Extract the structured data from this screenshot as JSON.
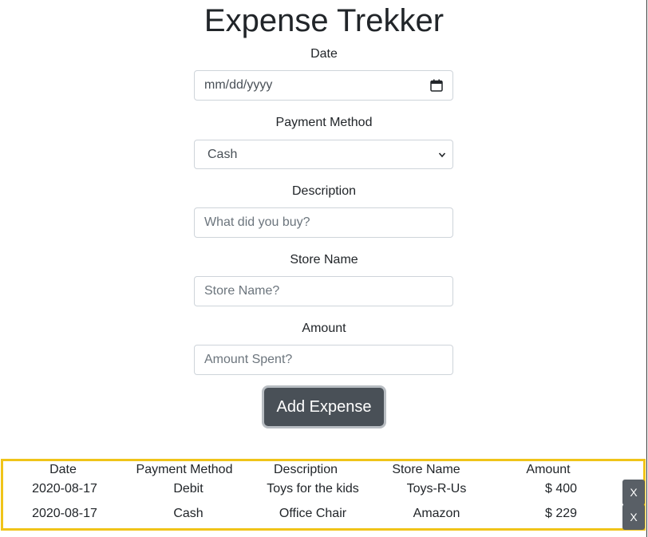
{
  "app": {
    "title": "Expense Trekker"
  },
  "form": {
    "date": {
      "label": "Date",
      "placeholder": "mm/dd/yyyy"
    },
    "payment_method": {
      "label": "Payment Method",
      "selected": "Cash"
    },
    "description": {
      "label": "Description",
      "placeholder": "What did you buy?"
    },
    "store_name": {
      "label": "Store Name",
      "placeholder": "Store Name?"
    },
    "amount": {
      "label": "Amount",
      "placeholder": "Amount Spent?"
    },
    "submit_label": "Add Expense"
  },
  "table": {
    "headers": [
      "Date",
      "Payment Method",
      "Description",
      "Store Name",
      "Amount"
    ],
    "rows": [
      {
        "date": "2020-08-17",
        "method": "Debit",
        "description": "Toys for the kids",
        "store": "Toys-R-Us",
        "amount": "$ 400",
        "delete_label": "X"
      },
      {
        "date": "2020-08-17",
        "method": "Cash",
        "description": "Office Chair",
        "store": "Amazon",
        "amount": "$ 229",
        "delete_label": "X"
      }
    ]
  },
  "colors": {
    "button_dark": "#495057",
    "table_border": "#f0c419"
  },
  "icons": {
    "date_picker": "calendar-icon",
    "select": "chevron-down-icon"
  }
}
